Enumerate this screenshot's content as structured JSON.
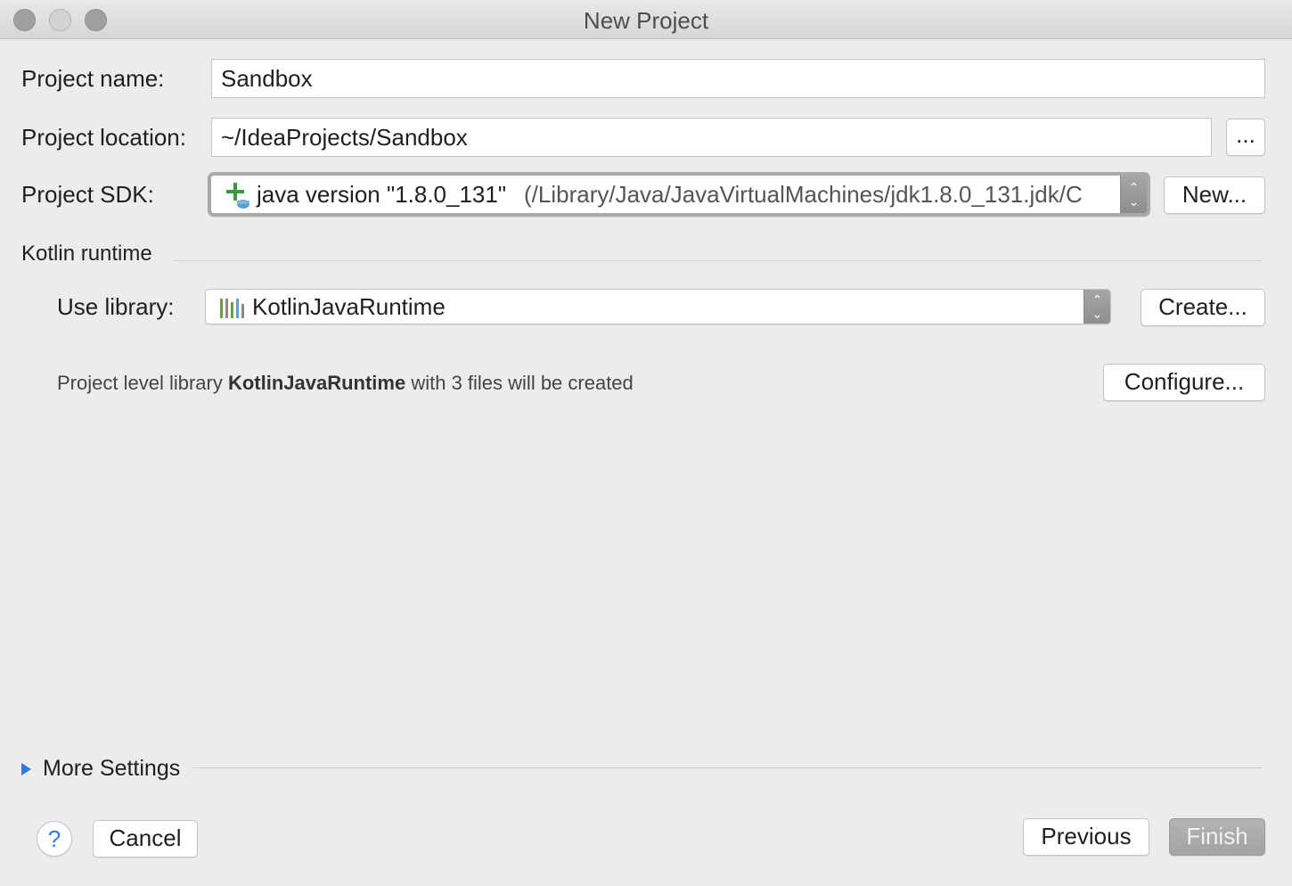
{
  "window": {
    "title": "New Project"
  },
  "form": {
    "project_name_label": "Project name:",
    "project_name_value": "Sandbox",
    "project_location_label": "Project location:",
    "project_location_value": "~/IdeaProjects/Sandbox",
    "browse_label": "...",
    "project_sdk_label": "Project SDK:",
    "sdk_version": "java version \"1.8.0_131\"",
    "sdk_path": "(/Library/Java/JavaVirtualMachines/jdk1.8.0_131.jdk/C",
    "new_sdk_label": "New..."
  },
  "kotlin": {
    "section_title": "Kotlin runtime",
    "use_library_label": "Use library:",
    "library_value": "KotlinJavaRuntime",
    "create_label": "Create...",
    "info_prefix": "Project level library ",
    "info_library": "KotlinJavaRuntime",
    "info_suffix": " with 3 files will be created",
    "configure_label": "Configure..."
  },
  "more_settings": {
    "label": "More Settings"
  },
  "footer": {
    "help_label": "?",
    "cancel_label": "Cancel",
    "previous_label": "Previous",
    "finish_label": "Finish"
  },
  "colors": {
    "window_bg": "#ececec",
    "help_blue": "#2f7ae5",
    "disabled_button": "#a8a8a8",
    "sdk_icon_green": "#3c9a3c",
    "library_icon_green": "#6a9f3c"
  },
  "icons": [
    "close-icon",
    "minimize-icon",
    "zoom-icon",
    "sdk-add-icon",
    "library-icon",
    "expand-triangle-icon",
    "help-icon"
  ]
}
